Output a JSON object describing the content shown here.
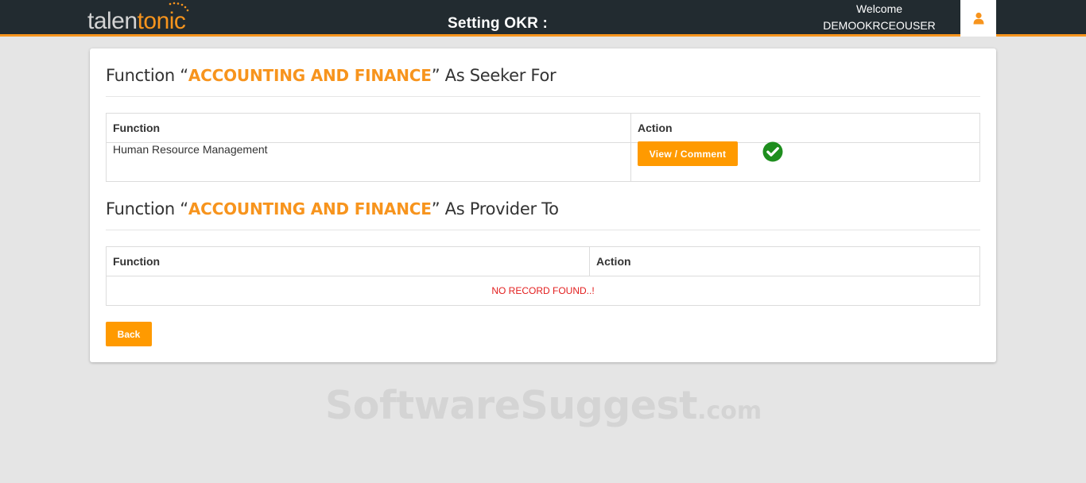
{
  "header": {
    "logo_part1": "talen",
    "logo_part2": "tonic",
    "page_title": "Setting OKR :",
    "welcome_label": "Welcome",
    "username": "DEMOOKRCEOUSER",
    "user_icon": "user-icon"
  },
  "seeker_section": {
    "title_prefix": "Function “",
    "function_name": "ACCOUNTING AND FINANCE",
    "title_suffix": "” As Seeker For",
    "columns": [
      "Function",
      "Action"
    ],
    "rows": [
      {
        "function": "Human Resource Management",
        "action_label": "View / Comment",
        "status_icon": "check-circle-icon"
      }
    ]
  },
  "provider_section": {
    "title_prefix": "Function “",
    "function_name": "ACCOUNTING AND FINANCE",
    "title_suffix": "” As Provider To",
    "columns": [
      "Function",
      "Action"
    ],
    "empty_message": "NO RECORD FOUND..!"
  },
  "back_label": "Back",
  "watermark": {
    "main": "SoftwareSuggest",
    "domain": ".com"
  },
  "colors": {
    "accent": "#f7941d",
    "button": "#ff9a00",
    "header_bg": "#222b30",
    "success": "#1e8e1e",
    "error": "#e31e1e"
  }
}
